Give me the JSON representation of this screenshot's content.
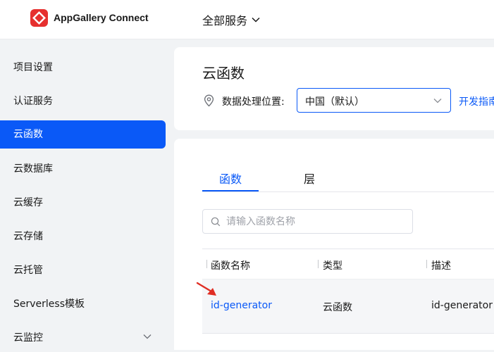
{
  "header": {
    "brand": "AppGallery Connect",
    "services_label": "全部服务",
    "brand_color": "#e6302f",
    "logo_icon": "huawei-agc-logo-icon"
  },
  "sidebar": {
    "items": [
      {
        "label": "项目设置"
      },
      {
        "label": "认证服务"
      },
      {
        "label": "云函数",
        "active": true
      },
      {
        "label": "云数据库"
      },
      {
        "label": "云缓存"
      },
      {
        "label": "云存储"
      },
      {
        "label": "云托管"
      },
      {
        "label": "Serverless模板"
      },
      {
        "label": "云监控",
        "expandable": true
      }
    ],
    "active_color": "#0a59f7"
  },
  "main": {
    "title": "云函数",
    "location_label": "数据处理位置:",
    "location_value": "中国（默认）",
    "dev_guide_link": "开发指南",
    "tabs": [
      {
        "label": "函数",
        "active": true
      },
      {
        "label": "层"
      }
    ],
    "search": {
      "placeholder": "请输入函数名称",
      "value": ""
    },
    "table": {
      "columns": [
        "函数名称",
        "类型",
        "描述"
      ],
      "rows": [
        {
          "name": "id-generator",
          "type": "云函数",
          "description": "id-generator"
        }
      ]
    },
    "accent_color": "#0a59f7"
  }
}
